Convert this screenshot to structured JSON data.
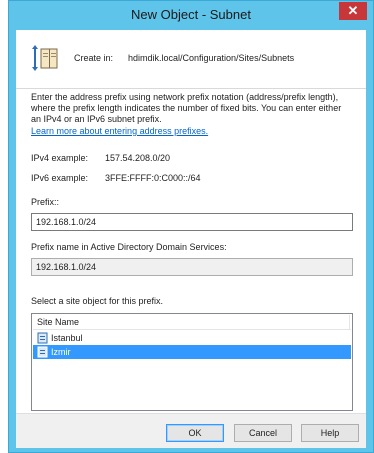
{
  "window": {
    "title": "New Object - Subnet",
    "close_glyph": "✕"
  },
  "header": {
    "icon": "subnet-object-icon",
    "create_in_label": "Create in:",
    "create_in_path": "hdimdik.local/Configuration/Sites/Subnets"
  },
  "description": "Enter the address prefix using network prefix notation (address/prefix length), where the prefix length indicates the number of fixed bits. You can enter either an IPv4 or an IPv6 subnet prefix.",
  "learn_more_link": "Learn more about entering address prefixes.",
  "examples": {
    "ipv4_label": "IPv4 example:",
    "ipv4_value": "157.54.208.0/20",
    "ipv6_label": "IPv6 example:",
    "ipv6_value": "3FFE:FFFF:0:C000::/64"
  },
  "prefix": {
    "label": "Prefix::",
    "value": "192.168.1.0/24"
  },
  "prefix_name": {
    "label": "Prefix name in Active Directory Domain Services:",
    "value": "192.168.1.0/24"
  },
  "sites": {
    "label": "Select a site object for this prefix.",
    "column_header": "Site Name",
    "items": [
      {
        "name": "Istanbul",
        "selected": false
      },
      {
        "name": "Izmir",
        "selected": true
      }
    ]
  },
  "buttons": {
    "ok": "OK",
    "cancel": "Cancel",
    "help": "Help"
  },
  "colors": {
    "title_bar": "#5fc4e9",
    "close_button": "#c7373a",
    "selection": "#3399ff",
    "link": "#0066cc"
  }
}
